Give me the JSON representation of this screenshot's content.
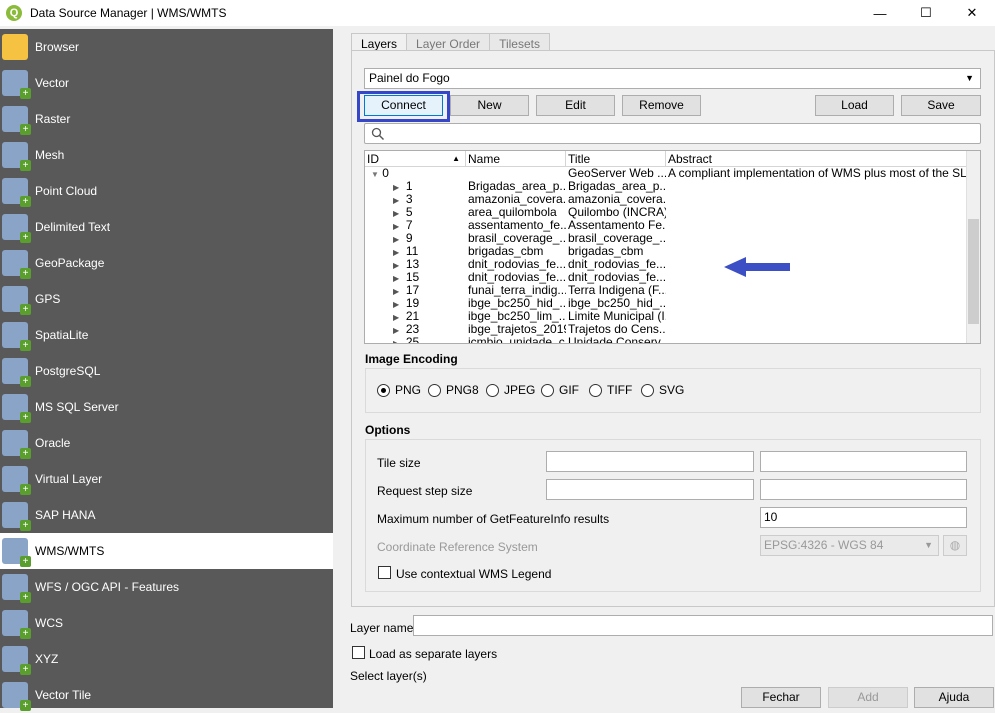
{
  "window": {
    "title": "Data Source Manager | WMS/WMTS",
    "min": "—",
    "max": "☐",
    "close": "✕",
    "logo": "Q"
  },
  "sidebar": {
    "items": [
      {
        "label": "Browser",
        "icon": "folder-icon"
      },
      {
        "label": "Vector",
        "icon": "vector-icon"
      },
      {
        "label": "Raster",
        "icon": "raster-icon"
      },
      {
        "label": "Mesh",
        "icon": "mesh-icon"
      },
      {
        "label": "Point Cloud",
        "icon": "point-cloud-icon"
      },
      {
        "label": "Delimited Text",
        "icon": "delimited-text-icon"
      },
      {
        "label": "GeoPackage",
        "icon": "geopackage-icon"
      },
      {
        "label": "GPS",
        "icon": "gps-icon"
      },
      {
        "label": "SpatiaLite",
        "icon": "spatialite-icon"
      },
      {
        "label": "PostgreSQL",
        "icon": "postgresql-icon"
      },
      {
        "label": "MS SQL Server",
        "icon": "mssql-icon"
      },
      {
        "label": "Oracle",
        "icon": "oracle-icon"
      },
      {
        "label": "Virtual Layer",
        "icon": "virtual-layer-icon"
      },
      {
        "label": "SAP HANA",
        "icon": "sap-hana-icon"
      },
      {
        "label": "WMS/WMTS",
        "icon": "wms-icon",
        "selected": true
      },
      {
        "label": "WFS / OGC API - Features",
        "icon": "wfs-icon"
      },
      {
        "label": "WCS",
        "icon": "wcs-icon"
      },
      {
        "label": "XYZ",
        "icon": "xyz-icon"
      },
      {
        "label": "Vector Tile",
        "icon": "vector-tile-icon"
      }
    ]
  },
  "tabs": [
    "Layers",
    "Layer Order",
    "Tilesets"
  ],
  "connection": {
    "selected": "Painel do Fogo"
  },
  "buttons": {
    "connect": "Connect",
    "new": "New",
    "edit": "Edit",
    "remove": "Remove",
    "load": "Load",
    "save": "Save"
  },
  "search": {
    "placeholder": ""
  },
  "tree": {
    "headers": [
      "ID",
      "Name",
      "Title",
      "Abstract"
    ],
    "root": {
      "id": "0",
      "name": "",
      "title": "GeoServer Web ...",
      "abstract": "A compliant implementation of WMS plus most of the SLD e..."
    },
    "rows": [
      {
        "id": "1",
        "name": "Brigadas_area_p...",
        "title": "Brigadas_area_p..."
      },
      {
        "id": "3",
        "name": "amazonia_covera...",
        "title": "amazonia_covera..."
      },
      {
        "id": "5",
        "name": "area_quilombola",
        "title": "Quilombo (INCRA)"
      },
      {
        "id": "7",
        "name": "assentamento_fe...",
        "title": "Assentamento Fe..."
      },
      {
        "id": "9",
        "name": "brasil_coverage_...",
        "title": "brasil_coverage_..."
      },
      {
        "id": "11",
        "name": "brigadas_cbm",
        "title": "brigadas_cbm"
      },
      {
        "id": "13",
        "name": "dnit_rodovias_fe...",
        "title": "dnit_rodovias_fe..."
      },
      {
        "id": "15",
        "name": "dnit_rodovias_fe...",
        "title": "dnit_rodovias_fe..."
      },
      {
        "id": "17",
        "name": "funai_terra_indig...",
        "title": "Terra Indigena (F..."
      },
      {
        "id": "19",
        "name": "ibge_bc250_hid_...",
        "title": "ibge_bc250_hid_..."
      },
      {
        "id": "21",
        "name": "ibge_bc250_lim_...",
        "title": "Limite Municipal (I..."
      },
      {
        "id": "23",
        "name": "ibge_trajetos_2019",
        "title": "Trajetos do Cens..."
      },
      {
        "id": "25",
        "name": "icmbio_unidade_c...",
        "title": "Unidade Conserv..."
      }
    ]
  },
  "encoding": {
    "label": "Image Encoding",
    "options": [
      "PNG",
      "PNG8",
      "JPEG",
      "GIF",
      "TIFF",
      "SVG"
    ],
    "selected": "PNG"
  },
  "options": {
    "label": "Options",
    "tile_size": "Tile size",
    "request_step": "Request step size",
    "max_gfi": "Maximum number of GetFeatureInfo results",
    "max_gfi_value": "10",
    "crs": "Coordinate Reference System",
    "crs_value": "EPSG:4326 - WGS 84",
    "contextual_legend": "Use contextual WMS Legend"
  },
  "footer": {
    "layer_name": "Layer name",
    "layer_name_value": "",
    "separate": "Load as separate layers",
    "select": "Select layer(s)",
    "close": "Fechar",
    "add": "Add",
    "help": "Ajuda"
  },
  "annotation": {
    "highlight_color": "#3546c9",
    "arrow_color": "#3d4fc4"
  }
}
